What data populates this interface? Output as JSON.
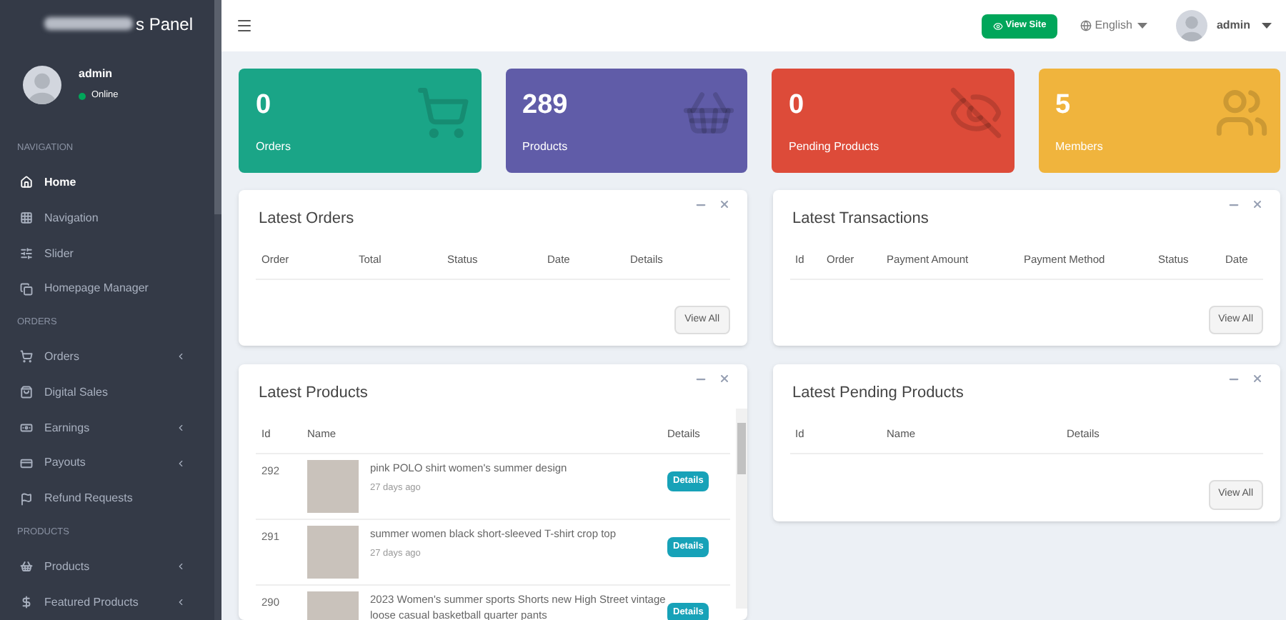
{
  "sidebar": {
    "logo": "s Panel",
    "user": {
      "name": "admin",
      "status": "Online"
    },
    "items": [
      {
        "kind": "header",
        "label": "NAVIGATION"
      },
      {
        "kind": "link",
        "label": "Home",
        "selected": true,
        "expandable": false
      },
      {
        "kind": "link",
        "label": "Navigation",
        "selected": false,
        "expandable": false
      },
      {
        "kind": "link",
        "label": "Slider",
        "selected": false,
        "expandable": false
      },
      {
        "kind": "link",
        "label": "Homepage Manager",
        "selected": false,
        "expandable": false
      },
      {
        "kind": "header",
        "label": "ORDERS"
      },
      {
        "kind": "link",
        "label": "Orders",
        "selected": false,
        "expandable": true
      },
      {
        "kind": "link",
        "label": "Digital Sales",
        "selected": false,
        "expandable": false
      },
      {
        "kind": "link",
        "label": "Earnings",
        "selected": false,
        "expandable": true
      },
      {
        "kind": "link",
        "label": "Payouts",
        "selected": false,
        "expandable": true
      },
      {
        "kind": "link",
        "label": "Refund Requests",
        "selected": false,
        "expandable": false
      },
      {
        "kind": "header",
        "label": "PRODUCTS"
      },
      {
        "kind": "link",
        "label": "Products",
        "selected": false,
        "expandable": true
      },
      {
        "kind": "link",
        "label": "Featured Products",
        "selected": false,
        "expandable": true
      }
    ]
  },
  "topbar": {
    "view_site": "View Site",
    "language": "English",
    "user": "admin"
  },
  "stats": [
    {
      "value": "0",
      "label": "Orders",
      "color": "#1aa587"
    },
    {
      "value": "289",
      "label": "Products",
      "color": "#605ca8"
    },
    {
      "value": "0",
      "label": "Pending Products",
      "color": "#dd4b39"
    },
    {
      "value": "5",
      "label": "Members",
      "color": "#f0b43d"
    }
  ],
  "latest_orders": {
    "title": "Latest Orders",
    "columns": [
      "Order",
      "Total",
      "Status",
      "Date",
      "Details"
    ],
    "button": "View All"
  },
  "latest_transactions": {
    "title": "Latest Transactions",
    "columns": [
      "Id",
      "Order",
      "Payment Amount",
      "Payment Method",
      "Status",
      "Date"
    ],
    "button": "View All"
  },
  "latest_products": {
    "title": "Latest Products",
    "columns": [
      "Id",
      "Name",
      "Details"
    ],
    "rows": [
      {
        "id": "292",
        "name": "pink POLO shirt women's summer design",
        "time": "27 days ago",
        "button": "Details"
      },
      {
        "id": "291",
        "name": "summer women black short-sleeved T-shirt crop top",
        "time": "27 days ago",
        "button": "Details"
      },
      {
        "id": "290",
        "name": "2023 Women's summer sports Shorts new High Street vintage loose casual basketball quarter pants",
        "button": "Details"
      }
    ]
  },
  "latest_pending_products": {
    "title": "Latest Pending Products",
    "columns": [
      "Id",
      "Name",
      "Details"
    ],
    "button": "View All"
  }
}
